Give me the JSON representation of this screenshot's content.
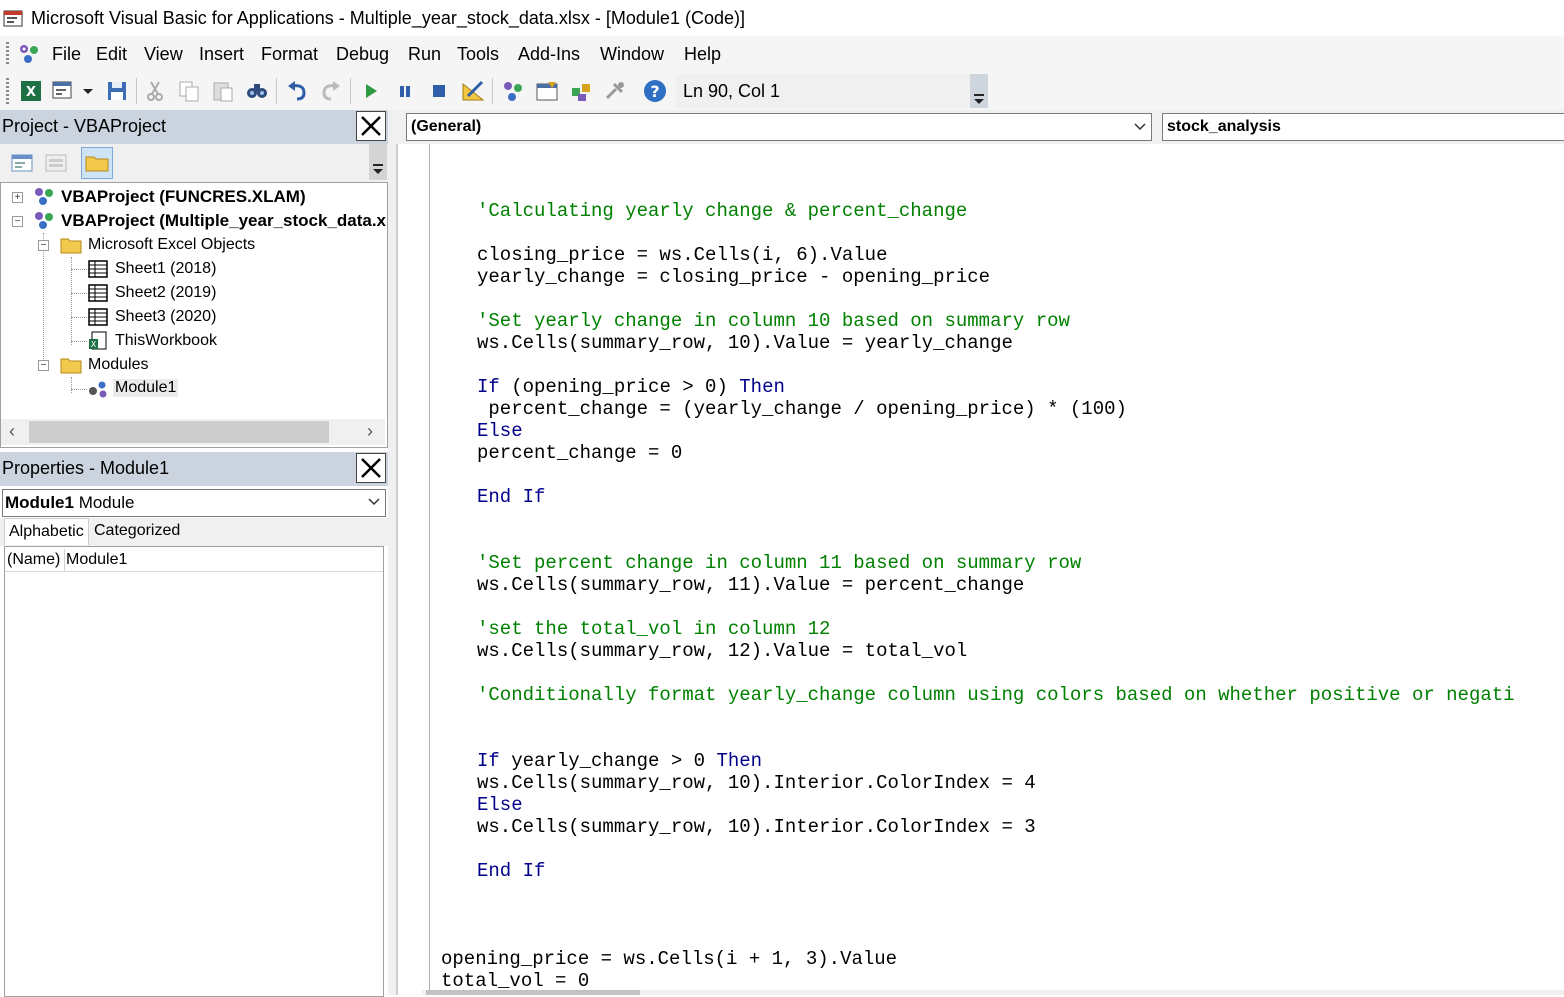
{
  "window": {
    "title": "Microsoft Visual Basic for Applications - Multiple_year_stock_data.xlsx - [Module1 (Code)]"
  },
  "menu": [
    "File",
    "Edit",
    "View",
    "Insert",
    "Format",
    "Debug",
    "Run",
    "Tools",
    "Add-Ins",
    "Window",
    "Help"
  ],
  "toolbar": {
    "status": "Ln 90, Col 1",
    "icons": [
      "excel-icon",
      "insert-module-icon",
      "save-icon",
      "cut-icon",
      "copy-icon",
      "paste-icon",
      "find-icon",
      "undo-icon",
      "redo-icon",
      "run-icon",
      "break-icon",
      "reset-icon",
      "design-mode-icon",
      "project-explorer-icon",
      "properties-window-icon",
      "object-browser-icon",
      "toolbox-icon",
      "help-icon"
    ]
  },
  "project_pane": {
    "title": "Project - VBAProject",
    "tree": [
      {
        "label": "VBAProject (FUNCRES.XLAM)",
        "bold": true
      },
      {
        "label": "VBAProject (Multiple_year_stock_data.x",
        "bold": true
      },
      {
        "label": "Microsoft Excel Objects"
      },
      {
        "label": "Sheet1 (2018)"
      },
      {
        "label": "Sheet2 (2019)"
      },
      {
        "label": "Sheet3 (2020)"
      },
      {
        "label": "ThisWorkbook"
      },
      {
        "label": "Modules"
      },
      {
        "label": "Module1"
      }
    ]
  },
  "properties_pane": {
    "title": "Properties - Module1",
    "object_bold": "Module1",
    "object_type": "Module",
    "tabs": [
      "Alphabetic",
      "Categorized"
    ],
    "rows": [
      {
        "name": "(Name)",
        "value": "Module1"
      }
    ]
  },
  "code_window": {
    "object_combo": "(General)",
    "procedure_combo": "stock_analysis",
    "lines": [
      {
        "k": "cm",
        "t": "'Calculating yearly change & percent_change",
        "i": 1
      },
      {
        "k": "",
        "t": "closing_price = ws.Cells(i, 6).Value",
        "i": 1
      },
      {
        "k": "",
        "t": "yearly_change = closing_price - opening_price",
        "i": 1
      },
      {
        "k": "cm",
        "t": "'Set yearly change in column 10 based on summary row",
        "i": 1
      },
      {
        "k": "",
        "t": "ws.Cells(summary_row, 10).Value = yearly_change",
        "i": 1
      },
      {
        "k": "if",
        "t": " (opening_price > 0) ",
        "i": 1
      },
      {
        "k": "",
        "t": " percent_change = (yearly_change / opening_price) * (100)",
        "i": 1
      },
      {
        "k": "kw",
        "t": "Else",
        "i": 1
      },
      {
        "k": "",
        "t": "percent_change = 0",
        "i": 1
      },
      {
        "k": "kw",
        "t": "End If",
        "i": 1
      },
      {
        "k": "cm",
        "t": "'Set percent change in column 11 based on summary row",
        "i": 1
      },
      {
        "k": "",
        "t": "ws.Cells(summary_row, 11).Value = percent_change",
        "i": 1
      },
      {
        "k": "cm",
        "t": "'set the total_vol in column 12",
        "i": 1
      },
      {
        "k": "",
        "t": "ws.Cells(summary_row, 12).Value = total_vol",
        "i": 1
      },
      {
        "k": "cm",
        "t": "'Conditionally format yearly_change column using colors based on whether positive or negati",
        "i": 1
      },
      {
        "k": "if",
        "t": " yearly_change > 0 ",
        "i": 1
      },
      {
        "k": "",
        "t": "ws.Cells(summary_row, 10).Interior.ColorIndex = 4",
        "i": 1
      },
      {
        "k": "kw",
        "t": "Else",
        "i": 1
      },
      {
        "k": "",
        "t": "ws.Cells(summary_row, 10).Interior.ColorIndex = 3",
        "i": 1
      },
      {
        "k": "kw",
        "t": "End If",
        "i": 1
      },
      {
        "k": "",
        "t": "opening_price = ws.Cells(i + 1, 3).Value",
        "i": 0
      },
      {
        "k": "",
        "t": "total_vol = 0",
        "i": 0
      }
    ],
    "keywords": {
      "if": "If",
      "then": "Then"
    }
  },
  "colors": {
    "keyword": "#00008b",
    "comment": "#008000",
    "pane_title": "#cad3de"
  }
}
